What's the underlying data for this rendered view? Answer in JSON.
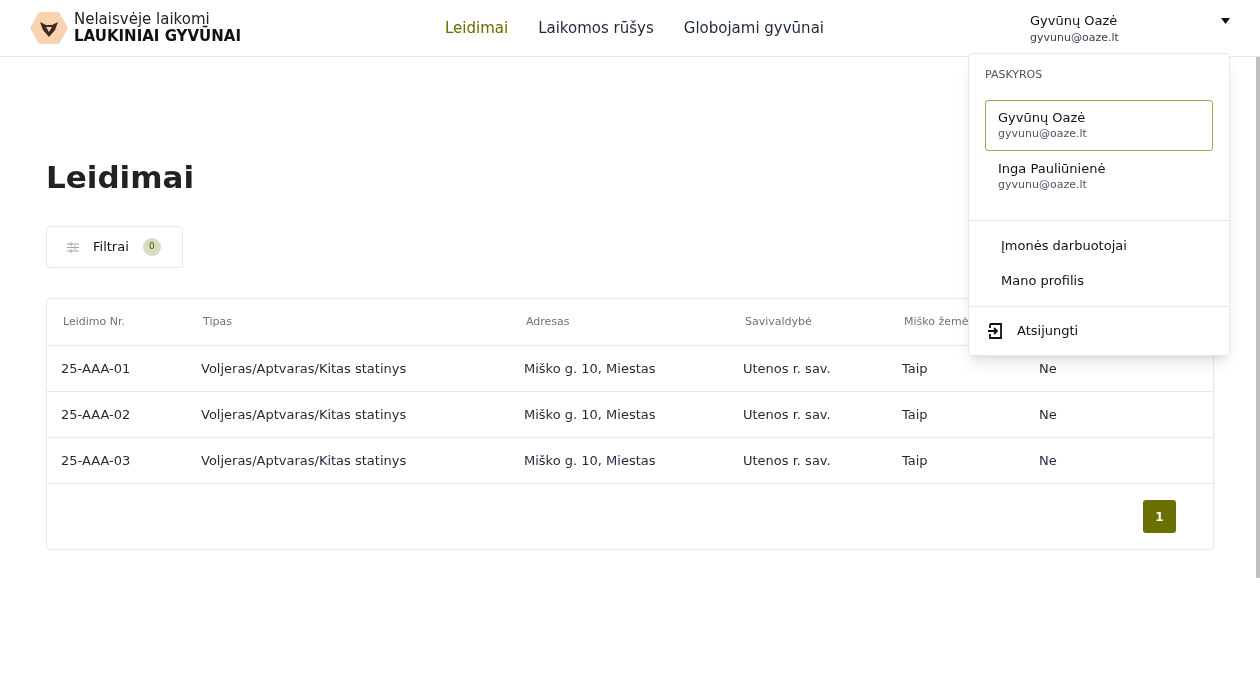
{
  "logo": {
    "line_1": "Nelaisvėje laikomi",
    "line_2": "LAUKINIAI GYVŪNAI"
  },
  "nav": [
    {
      "label": "Leidimai",
      "selected": true
    },
    {
      "label": "Laikomos rūšys",
      "selected": false
    },
    {
      "label": "Globojami gyvūnai",
      "selected": false
    }
  ],
  "account": {
    "name": "Gyvūnų Oazė",
    "email": "gyvunu@oaze.lt",
    "expanded": true
  },
  "page_title": "Leidimai",
  "filter": {
    "label": "Filtrai",
    "count": "0"
  },
  "table": {
    "columns": [
      "Leidimo Nr.",
      "Tipas",
      "Adresas",
      "Savivaldybė",
      "Miško žemė"
    ],
    "rows": [
      [
        "25-AAA-01",
        "Voljeras/Aptvaras/Kitas statinys",
        "Miško g. 10, Miestas",
        "Utenos r. sav.",
        "Taip",
        "Ne"
      ],
      [
        "25-AAA-02",
        "Voljeras/Aptvaras/Kitas statinys",
        "Miško g. 10, Miestas",
        "Utenos r. sav.",
        "Taip",
        "Ne"
      ],
      [
        "25-AAA-03",
        "Voljeras/Aptvaras/Kitas statinys",
        "Miško g. 10, Miestas",
        "Utenos r. sav.",
        "Taip",
        "Ne"
      ]
    ]
  },
  "pagination": [
    {
      "label": "1",
      "selected": true
    }
  ],
  "dropdown": {
    "heading": "PASKYROS",
    "accounts": [
      {
        "name": "Gyvūnų Oazė",
        "email": "gyvunu@oaze.lt",
        "selected": true
      },
      {
        "name": "Inga Pauliūnienė",
        "email": "gyvunu@oaze.lt",
        "selected": false
      }
    ],
    "links": [
      "Įmonės darbuotojai",
      "Mano profilis"
    ],
    "logout": "Atsijungti"
  }
}
